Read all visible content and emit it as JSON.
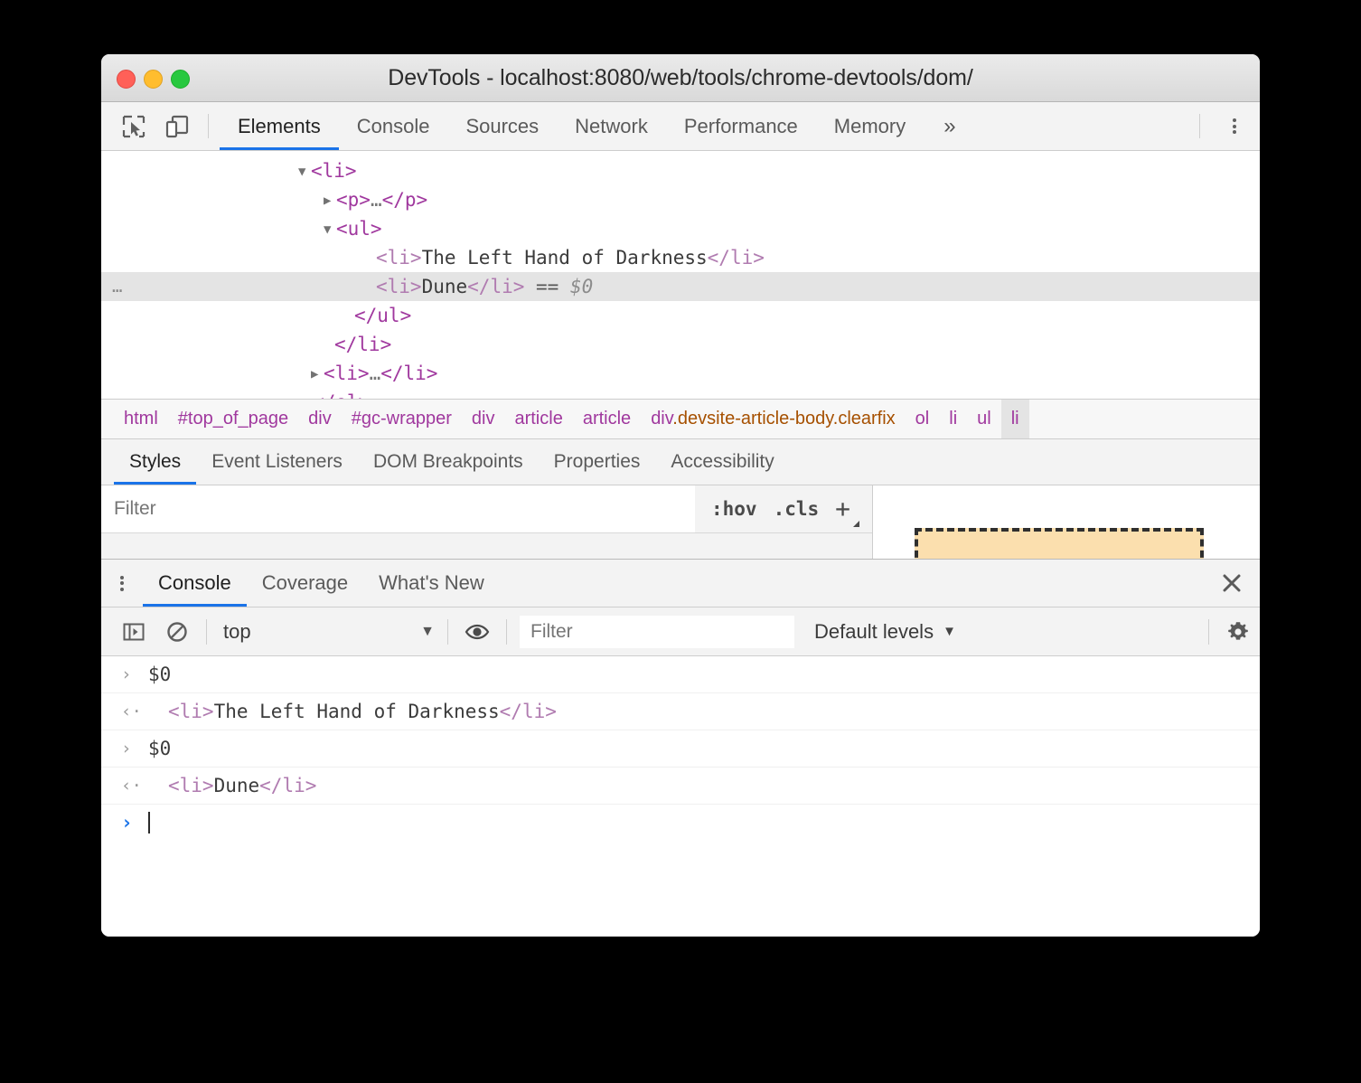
{
  "window": {
    "title": "DevTools - localhost:8080/web/tools/chrome-devtools/dom/",
    "traffic_lights": {
      "close_color": "#ff6058",
      "minimize_color": "#ffbd2e",
      "zoom_color": "#28c83f"
    }
  },
  "toolbar": {
    "inspect_icon": "inspect-element-icon",
    "device_icon": "device-toolbar-icon",
    "overflow_label": "»",
    "tabs": [
      {
        "label": "Elements",
        "active": true
      },
      {
        "label": "Console",
        "active": false
      },
      {
        "label": "Sources",
        "active": false
      },
      {
        "label": "Network",
        "active": false
      },
      {
        "label": "Performance",
        "active": false
      },
      {
        "label": "Memory",
        "active": false
      }
    ],
    "more_menu_icon": "kebab-menu-icon"
  },
  "dom_tree": {
    "rows": [
      {
        "indent": 218,
        "triangle": "▼",
        "parts": [
          {
            "t": "tag",
            "v": "<li>"
          }
        ],
        "selected": false
      },
      {
        "indent": 246,
        "triangle": "▶",
        "parts": [
          {
            "t": "tag",
            "v": "<p>"
          },
          {
            "t": "ell",
            "v": "…"
          },
          {
            "t": "tag",
            "v": "</p>"
          }
        ],
        "selected": false
      },
      {
        "indent": 246,
        "triangle": "▼",
        "parts": [
          {
            "t": "tag",
            "v": "<ul>"
          }
        ],
        "selected": false
      },
      {
        "indent": 290,
        "triangle": "",
        "parts": [
          {
            "t": "tag-dim",
            "v": "<li>"
          },
          {
            "t": "txt",
            "v": "The Left Hand of Darkness"
          },
          {
            "t": "tag-dim",
            "v": "</li>"
          }
        ],
        "selected": false
      },
      {
        "indent": 290,
        "triangle": "",
        "parts": [
          {
            "t": "tag-dim",
            "v": "<li>"
          },
          {
            "t": "txt",
            "v": "Dune"
          },
          {
            "t": "tag-dim",
            "v": "</li>"
          },
          {
            "t": "eqeq",
            "v": " == "
          },
          {
            "t": "sref",
            "v": "$0"
          }
        ],
        "selected": true,
        "gutter": "…"
      },
      {
        "indent": 266,
        "triangle": "",
        "parts": [
          {
            "t": "tag",
            "v": "</ul>"
          }
        ],
        "selected": false
      },
      {
        "indent": 244,
        "triangle": "",
        "parts": [
          {
            "t": "tag",
            "v": "</li>"
          }
        ],
        "selected": false
      },
      {
        "indent": 232,
        "triangle": "▶",
        "parts": [
          {
            "t": "tag",
            "v": "<li>"
          },
          {
            "t": "ell",
            "v": "…"
          },
          {
            "t": "tag",
            "v": "</li>"
          }
        ],
        "selected": false
      },
      {
        "indent": 220,
        "triangle": "",
        "parts": [
          {
            "t": "tag",
            "v": "</ol>"
          }
        ],
        "selected": false
      }
    ]
  },
  "breadcrumb": {
    "items": [
      {
        "label": "html",
        "selected": false,
        "styled": false
      },
      {
        "label": "#top_of_page",
        "selected": false,
        "styled": false
      },
      {
        "label": "div",
        "selected": false,
        "styled": false
      },
      {
        "label": "#gc-wrapper",
        "selected": false,
        "styled": false
      },
      {
        "label": "div",
        "selected": false,
        "styled": false
      },
      {
        "label": "article",
        "selected": false,
        "styled": false
      },
      {
        "label": "article",
        "selected": false,
        "styled": false
      },
      {
        "label": "div.devsite-article-body.clearfix",
        "tag": "div",
        "rest": ".devsite-article-body.clearfix",
        "selected": false,
        "styled": true
      },
      {
        "label": "ol",
        "selected": false,
        "styled": false
      },
      {
        "label": "li",
        "selected": false,
        "styled": false
      },
      {
        "label": "ul",
        "selected": false,
        "styled": false
      },
      {
        "label": "li",
        "selected": true,
        "styled": false
      }
    ]
  },
  "styles_pane": {
    "tabs": [
      {
        "label": "Styles",
        "active": true
      },
      {
        "label": "Event Listeners",
        "active": false
      },
      {
        "label": "DOM Breakpoints",
        "active": false
      },
      {
        "label": "Properties",
        "active": false
      },
      {
        "label": "Accessibility",
        "active": false
      }
    ],
    "filter_placeholder": "Filter",
    "filter_value": "",
    "hov_label": ":hov",
    "cls_label": ".cls",
    "new_rule_label": "+",
    "box_model": {
      "border_color": "#2f2f2f",
      "fill_color": "#fbdfae"
    }
  },
  "drawer": {
    "more_icon": "kebab-menu-icon",
    "tabs": [
      {
        "label": "Console",
        "active": true
      },
      {
        "label": "Coverage",
        "active": false
      },
      {
        "label": "What's New",
        "active": false
      }
    ],
    "close_icon": "close-icon",
    "toolbar": {
      "sidebar_icon": "console-sidebar-icon",
      "clear_icon": "clear-console-icon",
      "context_value": "top",
      "context_caret": "▼",
      "eye_icon": "live-expression-icon",
      "filter_placeholder": "Filter",
      "filter_value": "",
      "levels_label": "Default levels",
      "levels_caret": "▼",
      "settings_icon": "gear-icon"
    },
    "messages": [
      {
        "kind": "command",
        "marker": "›",
        "parts": [
          {
            "t": "txt",
            "v": "$0"
          }
        ]
      },
      {
        "kind": "result",
        "marker": "‹·",
        "parts": [
          {
            "t": "tag-dim",
            "v": "<li>"
          },
          {
            "t": "txt",
            "v": "The Left Hand of Darkness"
          },
          {
            "t": "tag-dim",
            "v": "</li>"
          }
        ]
      },
      {
        "kind": "command",
        "marker": "›",
        "parts": [
          {
            "t": "txt",
            "v": "$0"
          }
        ]
      },
      {
        "kind": "result",
        "marker": "‹·",
        "parts": [
          {
            "t": "tag-dim",
            "v": "<li>"
          },
          {
            "t": "txt",
            "v": "Dune"
          },
          {
            "t": "tag-dim",
            "v": "</li>"
          }
        ]
      }
    ],
    "prompt": {
      "marker": "›",
      "value": ""
    }
  }
}
